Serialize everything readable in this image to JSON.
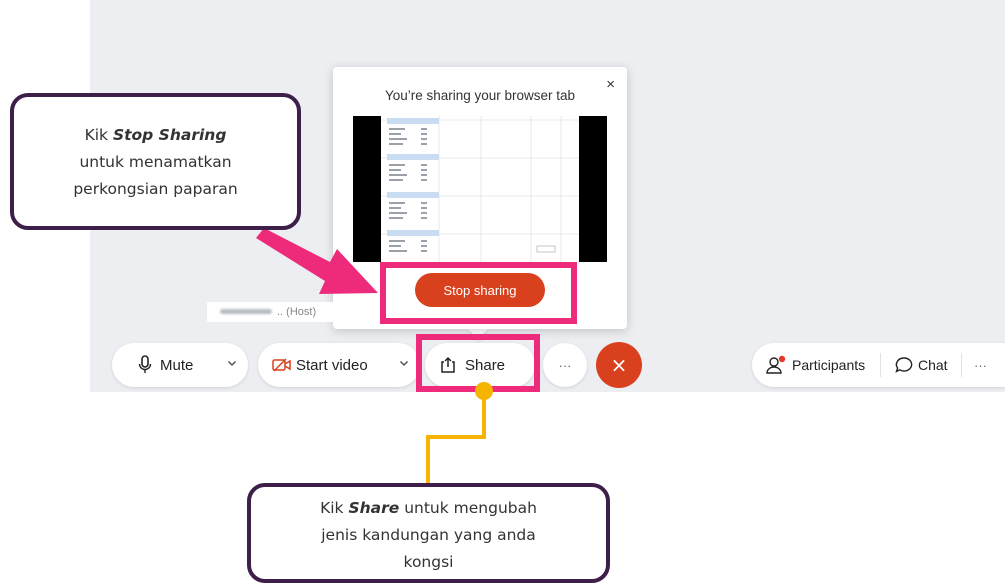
{
  "popover": {
    "title": "You’re sharing your browser tab",
    "close_icon": "×",
    "stop_button": "Stop sharing"
  },
  "host_label": ".. (Host)",
  "toolbar": {
    "mute_label": "Mute",
    "start_video_label": "Start video",
    "share_label": "Share",
    "more_label": "···",
    "end_icon": "×",
    "participants_label": "Participants",
    "chat_label": "Chat",
    "right_more_label": "···"
  },
  "callout_top": {
    "line1_prefix": "Kik ",
    "line1_emph": "Stop Sharing",
    "line2": "untuk menamatkan",
    "line3": "perkongsian paparan"
  },
  "callout_bottom": {
    "line1_prefix": "Kik ",
    "line1_emph": "Share",
    "line1_suffix": " untuk mengubah",
    "line2": "jenis kandungan yang anda",
    "line3": "kongsi"
  },
  "colors": {
    "highlight": "#ee2a7b",
    "stop_button": "#d8401e",
    "callout_border": "#3d1f4a",
    "connector": "#f5b400"
  },
  "icons": {
    "mute": "microphone-icon",
    "start_video": "video-off-icon",
    "share": "share-upload-icon",
    "participants": "participants-icon",
    "chat": "chat-bubble-icon"
  }
}
